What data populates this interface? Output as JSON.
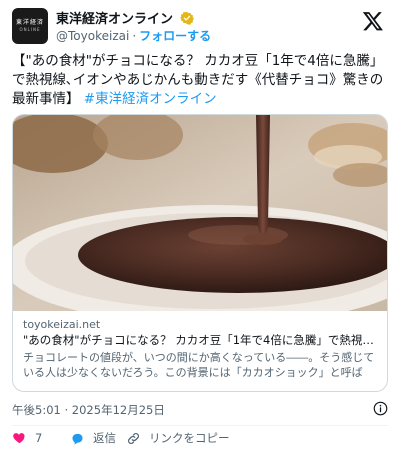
{
  "author": {
    "avatar_line1": "東洋経済",
    "avatar_line2": "ONLINE",
    "name": "東洋経済オンライン",
    "handle": "@Toyokeizai",
    "separator": "·",
    "follow_label": "フォローする"
  },
  "tweet": {
    "text": "【\"あの食材\"がチョコになる？ カカオ豆「1年で4倍に急騰」で熱視線､イオンやあじかんも動きだす《代替チョコ》驚きの最新事情】",
    "hashtag": "#東洋経済オンライン"
  },
  "card": {
    "domain": "toyokeizai.net",
    "title": "\"あの食材\"がチョコになる？ カカオ豆「1年で4倍に急騰」で熱視線､イオ...",
    "description": "チョコレートの値段が、いつの間にか高くなっている――。そう感じている人は少なくないだろう。この背景には「カカオショック」と呼ばれ..."
  },
  "meta": {
    "time": "午後5:01",
    "separator": " · ",
    "date": "2025年12月25日"
  },
  "actions": {
    "like_count": "7",
    "reply_label": "返信",
    "copy_label": "リンクをコピー"
  },
  "colors": {
    "accent": "#1d9bf0",
    "like": "#f91880",
    "secondary_text": "#536471",
    "border": "#cfd9de"
  },
  "icons": [
    "verified-badge-icon",
    "x-logo-icon",
    "info-icon",
    "heart-icon",
    "reply-icon",
    "link-icon"
  ]
}
